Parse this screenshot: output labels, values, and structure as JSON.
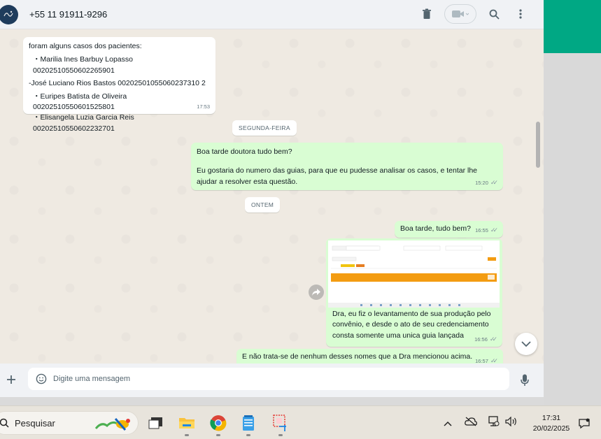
{
  "colors": {
    "brand_green": "#00a884",
    "incoming_bubble": "#ffffff",
    "outgoing_bubble": "#d9fdd3",
    "chat_bg": "#efeae2",
    "header_bg": "#f0f2f5"
  },
  "header": {
    "contact_name": "+55 11 91911-9296",
    "icons": [
      "delete-icon",
      "video-call-icon",
      "search-icon",
      "menu-icon"
    ]
  },
  "messages": {
    "m1": {
      "intro": "foram alguns casos dos pacientes:",
      "lines": [
        "・Marilia Ines Barbuy Lopasso 00202510550602265901",
        "-José Luciano Rios Bastos 00202501055060237310 2",
        "・Euripes Batista de Oliveira 00202510550601525801",
        "・Elisangela Luzia Garcia Reis 00202510550602232701"
      ],
      "time": "17:53"
    },
    "chip_monday": "SEGUNDA-FEIRA",
    "m2": {
      "line1": "Boa tarde doutora tudo bem?",
      "line2": "Eu gostaria do numero das guias, para que eu pudesse analisar os casos, e tentar lhe ajudar a resolver esta questão.",
      "time": "15:20"
    },
    "chip_yesterday": "ONTEM",
    "m3": {
      "text": "Boa tarde, tudo bem?",
      "time": "16:55"
    },
    "m4": {
      "text": "Dra, eu fiz o levantamento de sua produção pelo convênio, e desde o ato de seu credenciamento consta somente uma unica guia lançada",
      "time": "16:56"
    },
    "m5": {
      "text": "E não trata-se de nenhum desses nomes que a Dra mencionou acima.",
      "time": "16:57"
    }
  },
  "composer": {
    "placeholder": "Digite uma mensagem"
  },
  "taskbar": {
    "search_label": "Pesquisar",
    "clock_time": "17:31",
    "clock_date": "20/02/2025",
    "apps": [
      "task-view-icon",
      "file-explorer-icon",
      "chrome-icon",
      "notepad-icon",
      "snipping-tool-icon"
    ]
  }
}
